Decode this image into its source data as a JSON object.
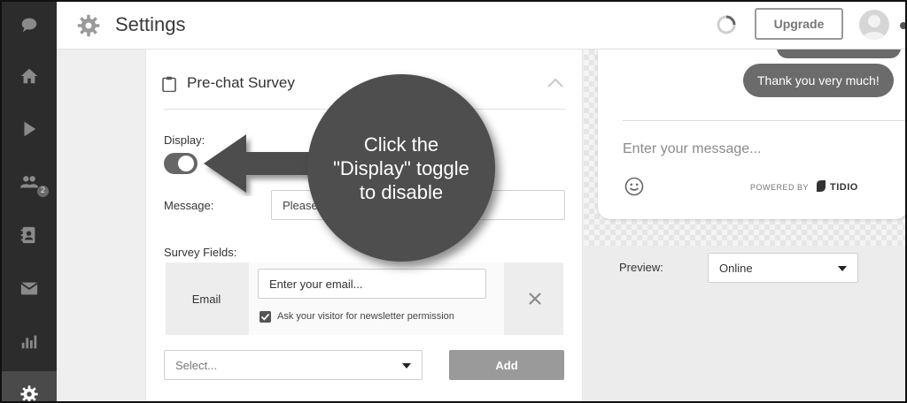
{
  "header": {
    "title": "Settings",
    "upgrade_label": "Upgrade"
  },
  "sidebar": {
    "items": [
      {
        "icon": "chat-bubble-icon"
      },
      {
        "icon": "home-icon"
      },
      {
        "icon": "play-icon"
      },
      {
        "icon": "visitors-icon",
        "badge": "2"
      },
      {
        "icon": "contacts-icon"
      },
      {
        "icon": "mail-icon"
      },
      {
        "icon": "analytics-icon"
      },
      {
        "icon": "gear-icon",
        "active": true
      }
    ]
  },
  "survey": {
    "title": "Pre-chat Survey",
    "display_label": "Display:",
    "display_enabled": true,
    "message_label": "Message:",
    "message_value": "Please l",
    "fields_label": "Survey Fields:",
    "field_name": "Email",
    "email_placeholder": "Enter your email...",
    "newsletter_label": "Ask your visitor for newsletter permission",
    "newsletter_checked": true,
    "select_placeholder": "Select...",
    "add_label": "Add"
  },
  "chat_preview": {
    "message": "Thank you very much!",
    "input_placeholder": "Enter your message...",
    "powered_by": "POWERED BY",
    "brand": "TIDIO",
    "preview_label": "Preview:",
    "preview_value": "Online"
  },
  "callout": {
    "text": "Click the \"Display\" toggle to disable"
  },
  "colors": {
    "sidebar": "#2c2c2c",
    "callout": "#4e4e4e",
    "toggle_on": "#666666",
    "add_button": "#9a9a9a"
  }
}
